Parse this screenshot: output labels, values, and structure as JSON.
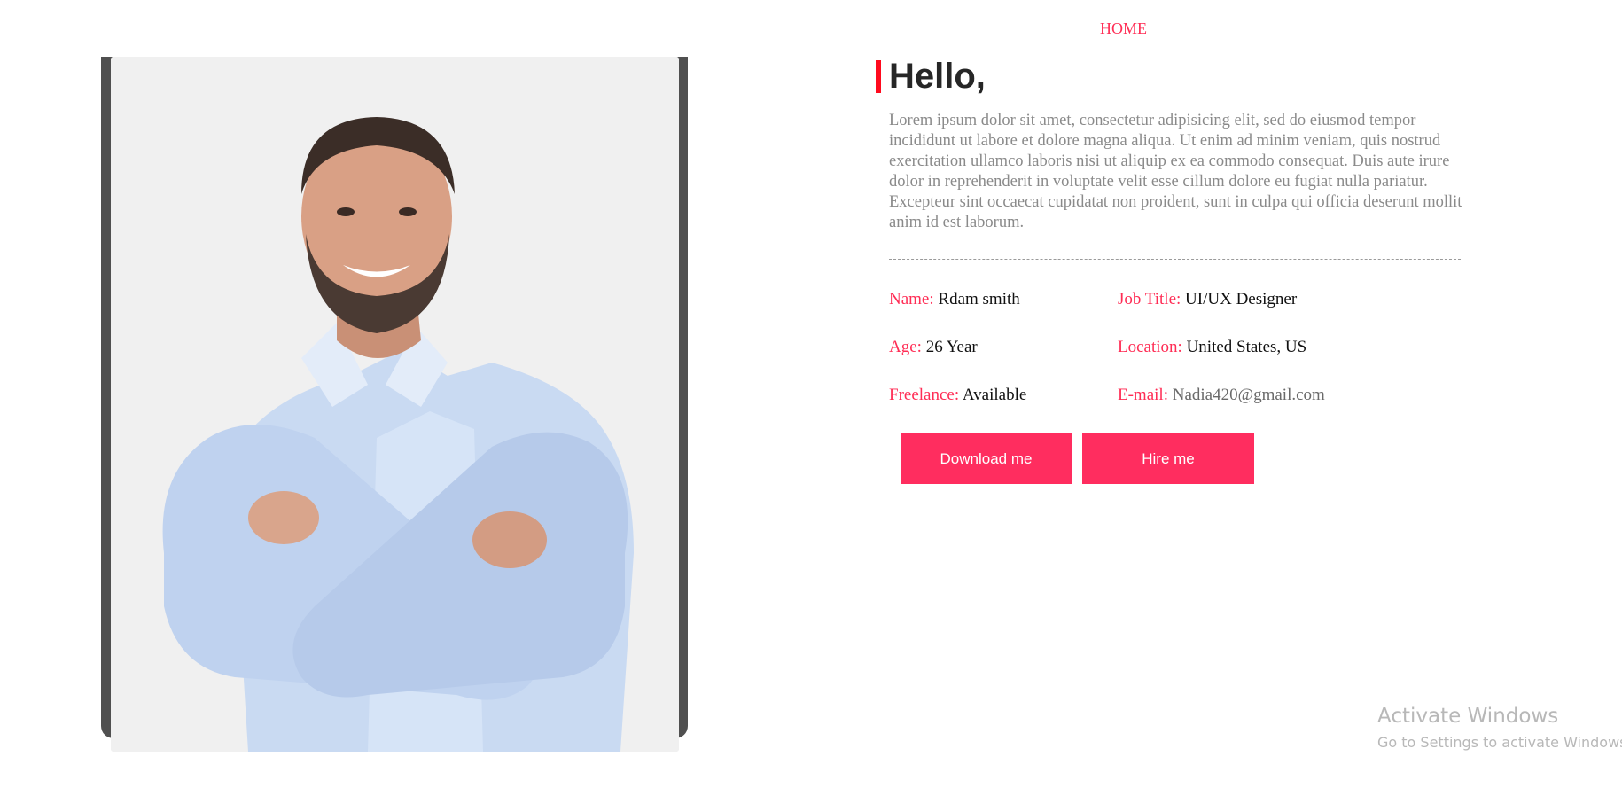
{
  "nav": {
    "home_label": "HOME"
  },
  "profile": {
    "photo_alt": "Smiling man in light blue shirt with arms crossed",
    "greeting": "Hello,",
    "bio": "Lorem ipsum dolor sit amet, consectetur adipisicing elit, sed do eiusmod tempor incididunt ut labore et dolore magna aliqua. Ut enim ad minim veniam, quis nostrud exercitation ullamco laboris nisi ut aliquip ex ea commodo consequat. Duis aute irure dolor in reprehenderit in voluptate velit esse cillum dolore eu fugiat nulla pariatur. Excepteur sint occaecat cupidatat non proident, sunt in culpa qui officia deserunt mollit anim id est laborum."
  },
  "info": {
    "name": {
      "label": "Name:",
      "value": "Rdam smith"
    },
    "job_title": {
      "label": "Job Title:",
      "value": "UI/UX Designer"
    },
    "age": {
      "label": "Age:",
      "value": "26 Year"
    },
    "location": {
      "label": "Location:",
      "value": "United States, US"
    },
    "freelance": {
      "label": "Freelance:",
      "value": "Available"
    },
    "email": {
      "label": "E-mail:",
      "value": "Nadia420@gmail.com"
    }
  },
  "buttons": {
    "download_label": "Download me",
    "hire_label": "Hire me"
  },
  "watermark": {
    "title": "Activate Windows",
    "subtitle": "Go to Settings to activate Windows."
  },
  "colors": {
    "accent": "#ff2d55",
    "bar_red": "#ff0a1e",
    "frame_dark": "#505050"
  }
}
